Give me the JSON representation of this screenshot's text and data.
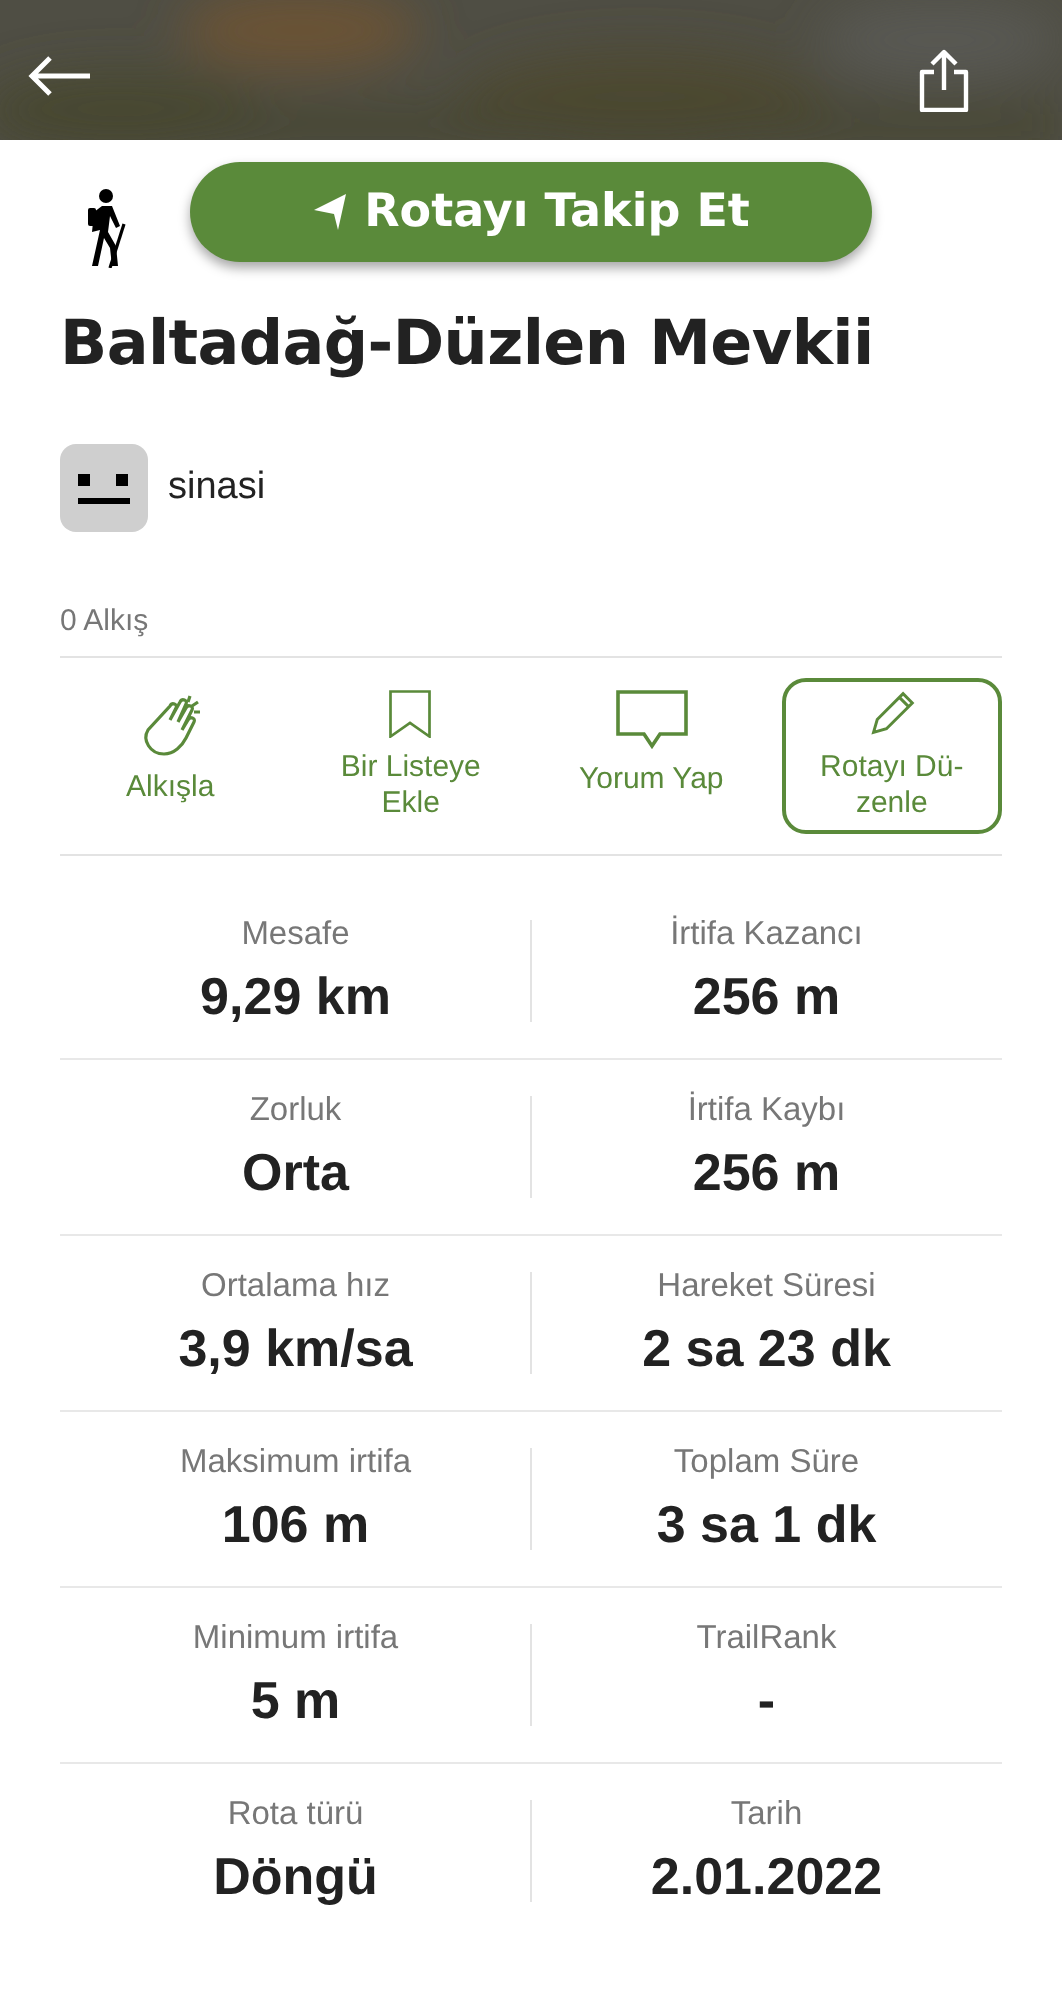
{
  "follow_button": {
    "label": "Rotayı Takip Et"
  },
  "route": {
    "title": "Baltadağ-Düzlen Mevkii"
  },
  "author": {
    "name": "sinasi"
  },
  "claps": {
    "count": "0 Alkış"
  },
  "actions": [
    {
      "kind": "clap",
      "label": "Alkışla",
      "outlined": false
    },
    {
      "kind": "bookmark",
      "label": "Bir Listeye Ekle",
      "outlined": false
    },
    {
      "kind": "comment",
      "label": "Yorum Yap",
      "outlined": false
    },
    {
      "kind": "edit",
      "label": "Rotayı Dü-zenle",
      "outlined": true
    }
  ],
  "stats": [
    {
      "label": "Mesafe",
      "value": "9,29 km"
    },
    {
      "label": "İrtifa Kazancı",
      "value": "256 m"
    },
    {
      "label": "Zorluk",
      "value": "Orta"
    },
    {
      "label": "İrtifa Kaybı",
      "value": "256 m"
    },
    {
      "label": "Ortalama hız",
      "value": "3,9 km/sa"
    },
    {
      "label": "Hareket Süresi",
      "value": "2 sa 23 dk"
    },
    {
      "label": "Maksimum irtifa",
      "value": "106 m"
    },
    {
      "label": "Toplam Süre",
      "value": "3 sa 1 dk"
    },
    {
      "label": "Minimum irtifa",
      "value": "5 m"
    },
    {
      "label": "TrailRank",
      "value": "-"
    },
    {
      "label": "Rota türü",
      "value": "Döngü"
    },
    {
      "label": "Tarih",
      "value": "2.01.2022"
    }
  ]
}
